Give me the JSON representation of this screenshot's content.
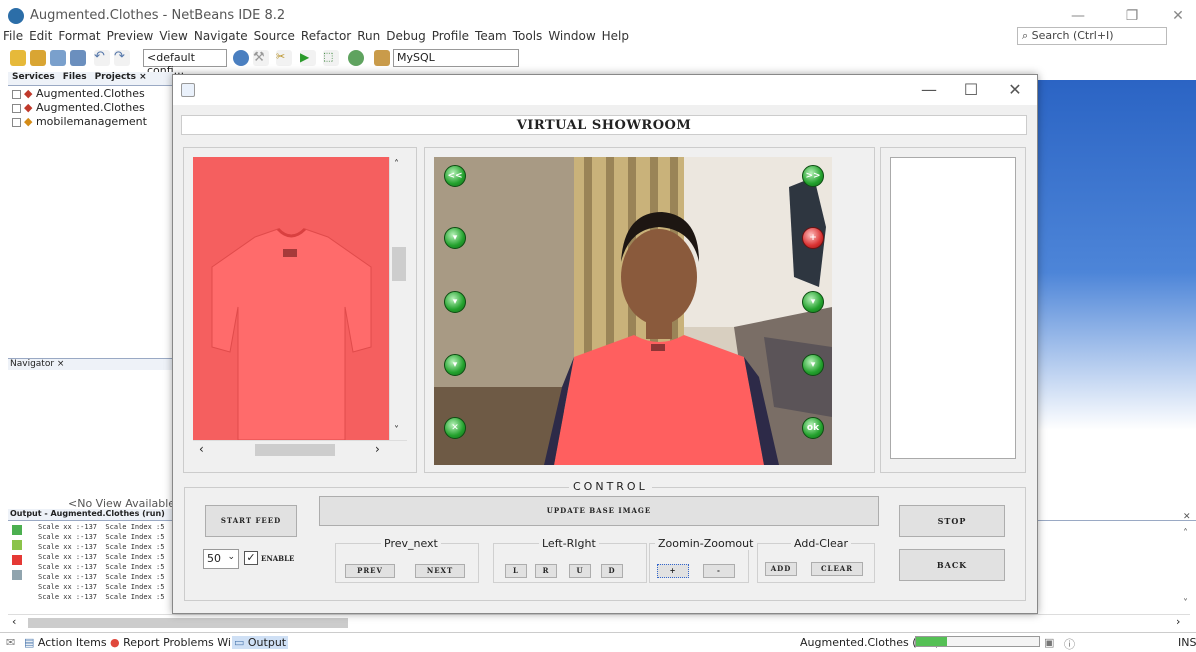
{
  "ide": {
    "title": "Augmented.Clothes - NetBeans IDE 8.2",
    "menu": [
      "File",
      "Edit",
      "Format",
      "Preview",
      "View",
      "Navigate",
      "Source",
      "Refactor",
      "Run",
      "Debug",
      "Profile",
      "Team",
      "Tools",
      "Window",
      "Help"
    ],
    "search_placeholder": "Search (Ctrl+I)",
    "config_combo": "<default confi...",
    "db_combo": "MySQL",
    "panel_tabs": [
      "Services",
      "Files",
      "Projects ×"
    ],
    "projects": [
      "Augmented.Clothes",
      "Augmented.Clothes",
      "mobilemanagement"
    ],
    "navigator_tab": "Navigator ×",
    "no_view": "<No View Available>",
    "output_tab": "Output - Augmented.Clothes (run)",
    "output_lines": [
      "Scale xx :-137  Scale Index :5",
      "Scale xx :-137  Scale Index :5",
      "Scale xx :-137  Scale Index :5",
      "Scale xx :-137  Scale Index :5",
      "Scale xx :-137  Scale Index :5",
      "Scale xx :-137  Scale Index :5",
      "Scale xx :-137  Scale Index :5",
      "Scale xx :-137  Scale Index :5"
    ],
    "status_items": [
      "Action Items",
      "Report Problems Window",
      "Output"
    ],
    "run_status": "Augmented.Clothes (run)",
    "run_progress": 0.25,
    "ins": "INS"
  },
  "dialog": {
    "heading": "VIRTUAL SHOWROOM",
    "control_label": "CONTROL",
    "start_feed": "START FEED",
    "update_base": "UPDATE BASE IMAGE",
    "stop": "STOP",
    "back": "BACK",
    "scale_value": "50",
    "enable": "ENABLE",
    "enable_checked": true,
    "groups": {
      "prev_next": {
        "label": "Prev_next",
        "buttons": [
          "PREV",
          "NEXT"
        ]
      },
      "left_right": {
        "label": "Left-RIght",
        "buttons": [
          "L",
          "R",
          "U",
          "D"
        ]
      },
      "zoom": {
        "label": "Zoomin-Zoomout",
        "buttons": [
          "+",
          "-"
        ]
      },
      "add_clear": {
        "label": "Add-Clear",
        "buttons": [
          "ADD",
          "CLEAR"
        ]
      }
    },
    "camera_left_buttons": [
      "<<",
      "▾",
      "▾",
      "▾",
      "✕"
    ],
    "camera_right_buttons": [
      ">>",
      "+",
      "▾",
      "▾",
      "ok"
    ]
  }
}
